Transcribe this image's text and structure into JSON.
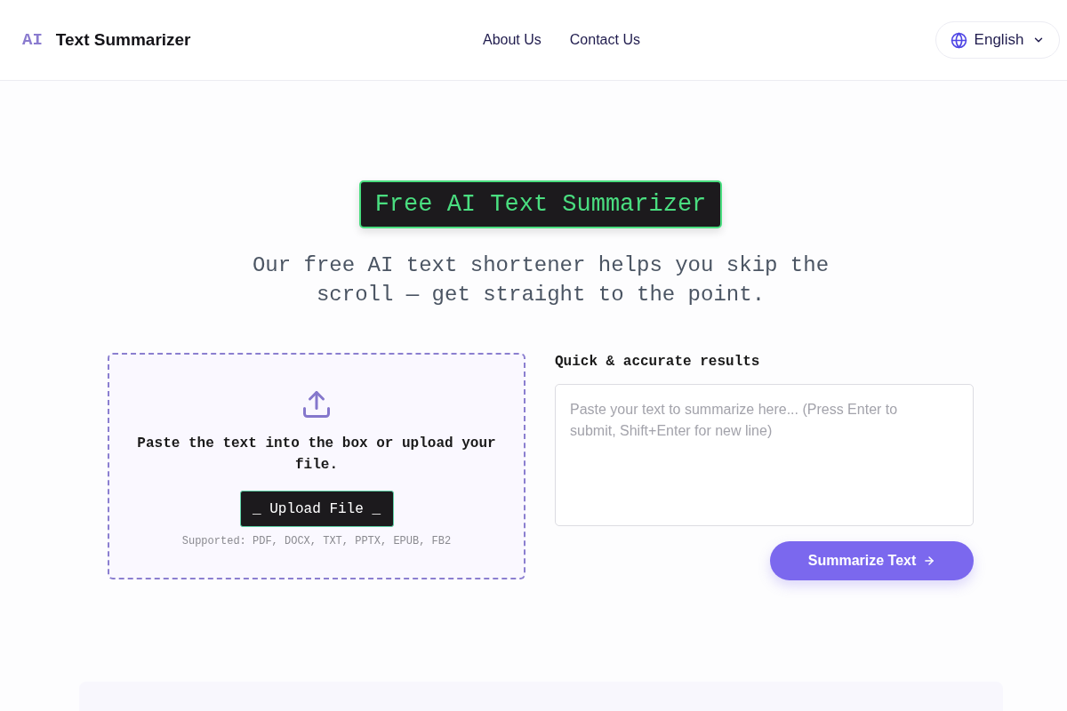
{
  "header": {
    "logo": {
      "mark": "AI",
      "name": "Text Summarizer"
    },
    "nav": [
      {
        "label": "About Us"
      },
      {
        "label": "Contact Us"
      }
    ],
    "language": {
      "label": "English"
    }
  },
  "hero": {
    "title": "Free AI Text Summarizer",
    "subtitle": "Our free AI text shortener helps you skip the scroll — get straight to the point."
  },
  "upload": {
    "instruction": "Paste the text into the box or upload your file.",
    "button": "_ Upload File _",
    "supported": "Supported: PDF, DOCX, TXT, PPTX, EPUB, FB2"
  },
  "input": {
    "label": "Quick & accurate results",
    "placeholder": "Paste your text to summarize here... (Press Enter to submit, Shift+Enter for new line)",
    "button": "Summarize Text"
  }
}
